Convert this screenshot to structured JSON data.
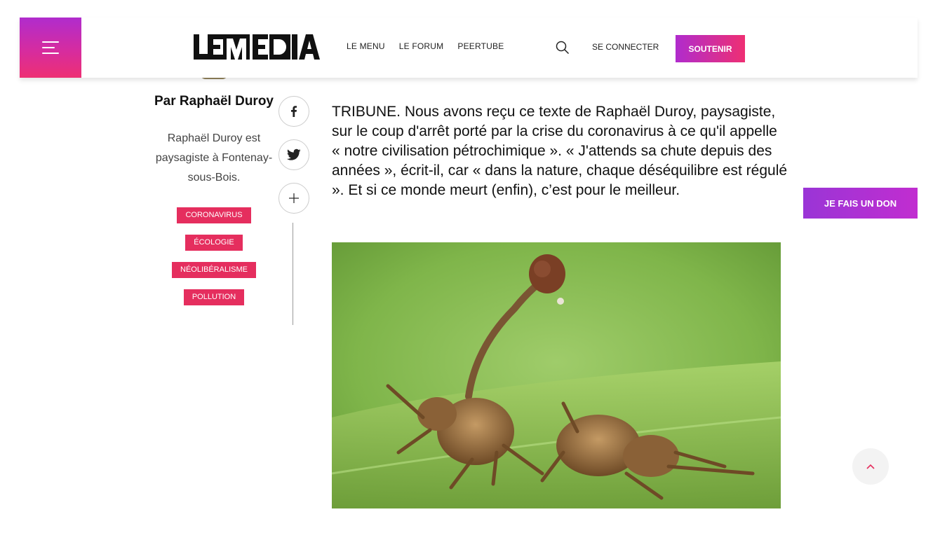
{
  "header": {
    "logo_text": "LE MEDIA",
    "nav": [
      "LE MENU",
      "LE FORUM",
      "PEERTUBE"
    ],
    "login_label": "SE CONNECTER",
    "support_label": "SOUTENIR",
    "icons": {
      "menu": "hamburger-icon",
      "search": "search-icon"
    }
  },
  "author": {
    "name": "Par Raphaël Duroy",
    "bio": "Raphaël Duroy est paysagiste à Fontenay-sous-Bois.",
    "tags": [
      "CORONAVIRUS",
      "ÉCOLOGIE",
      "NÉOLIBÉRALISME",
      "POLLUTION"
    ]
  },
  "share": {
    "icons": [
      "facebook-icon",
      "twitter-icon",
      "plus-icon"
    ]
  },
  "article": {
    "lede": "TRIBUNE. Nous avons reçu ce texte de Raphaël Duroy, paysagiste, sur le coup d'arrêt porté par la crise du coronavirus à ce qu'il appelle « notre civilisation pétrochimique ». « J'attends sa chute depuis des années », écrit-il, car « dans la nature, chaque déséquilibre est régulé ». Et si ce monde meurt (enfin), c’est pour le meilleur."
  },
  "donate_label": "JE FAIS UN DON",
  "colors": {
    "accent_pink": "#e52e5e",
    "accent_purple": "#b02ccd",
    "donate_purple": "#9a35d6"
  }
}
